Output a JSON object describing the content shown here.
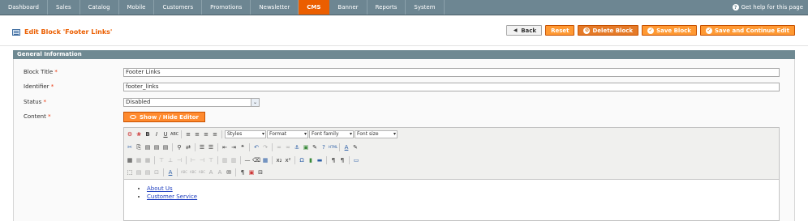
{
  "nav": {
    "items": [
      "Dashboard",
      "Sales",
      "Catalog",
      "Mobile",
      "Customers",
      "Promotions",
      "Newsletter",
      "CMS",
      "Banner",
      "Reports",
      "System"
    ],
    "active": "CMS",
    "help": "Get help for this page"
  },
  "page": {
    "title": "Edit Block 'Footer Links'"
  },
  "buttons": {
    "back": "Back",
    "reset": "Reset",
    "delete": "Delete Block",
    "save": "Save Block",
    "save_continue": "Save and Continue Edit"
  },
  "section": {
    "title": "General Information"
  },
  "form": {
    "block_title_label": "Block Title",
    "block_title_value": "Footer Links",
    "identifier_label": "Identifier",
    "identifier_value": "footer_links",
    "status_label": "Status",
    "status_value": "Disabled",
    "content_label": "Content",
    "required_mark": "*"
  },
  "editor": {
    "show_hide": "Show / Hide Editor",
    "styles": "Styles",
    "format": "Format",
    "font_family": "Font family",
    "font_size": "Font size",
    "links": [
      "About Us",
      "Customer Service"
    ]
  },
  "colors": {
    "accent": "#eb5e00",
    "nav_bg": "#6d8692",
    "section_bg": "#6f8992"
  }
}
